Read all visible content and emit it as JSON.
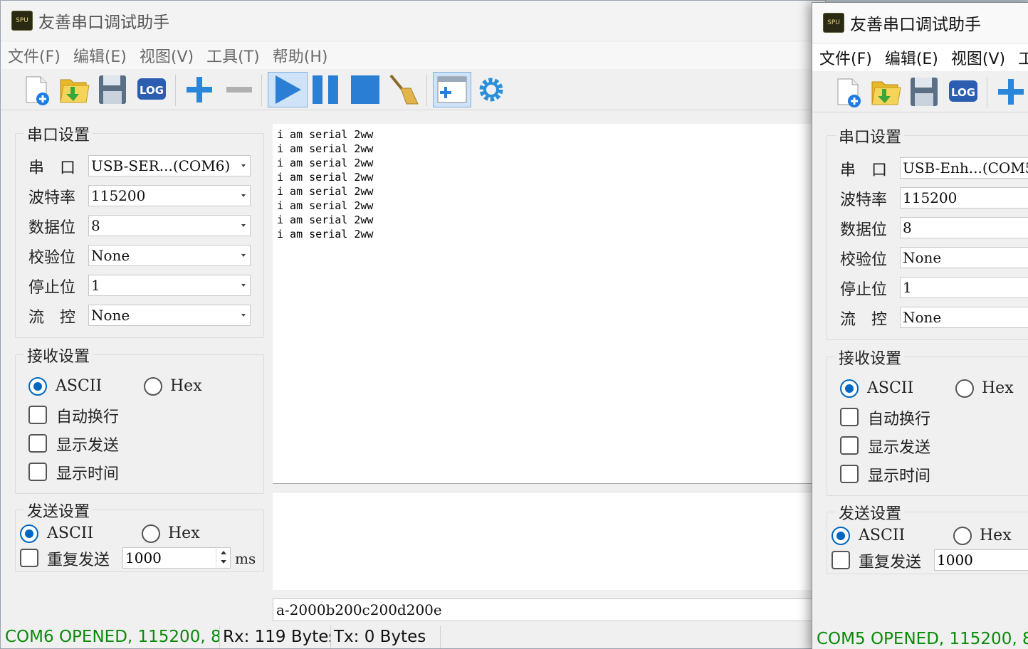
{
  "left_window": {
    "title": "友善串口调试助手",
    "icon_text": "SPU",
    "menu": [
      "文件(F)",
      "编辑(E)",
      "视图(V)",
      "工具(T)",
      "帮助(H)"
    ],
    "serial_settings": {
      "title": "串口设置",
      "port_label": "串　口",
      "port_value": "USB-SER...(COM6)",
      "baud_label": "波特率",
      "baud_value": "115200",
      "databits_label": "数据位",
      "databits_value": "8",
      "parity_label": "校验位",
      "parity_value": "None",
      "stopbits_label": "停止位",
      "stopbits_value": "1",
      "flow_label": "流　控",
      "flow_value": "None"
    },
    "receive_settings": {
      "title": "接收设置",
      "ascii_label": "ASCII",
      "hex_label": "Hex",
      "ascii_selected": true,
      "auto_wrap_label": "自动换行",
      "show_send_label": "显示发送",
      "show_time_label": "显示时间"
    },
    "send_settings": {
      "title": "发送设置",
      "ascii_label": "ASCII",
      "hex_label": "Hex",
      "ascii_selected": true,
      "repeat_label": "重复发送",
      "repeat_value": "1000",
      "unit": "ms"
    },
    "receive_lines": [
      "i am serial 2ww",
      "i am serial 2ww",
      "i am serial 2ww",
      "i am serial 2ww",
      "i am serial 2ww",
      "i am serial 2ww",
      "i am serial 2ww",
      "i am serial 2ww"
    ],
    "send_input_value": "a-2000b200c200d200e",
    "status": {
      "port": "COM6 OPENED, 115200, 8",
      "rx": "Rx: 119 Bytes",
      "tx": "Tx: 0 Bytes"
    }
  },
  "right_window": {
    "title": "友善串口调试助手",
    "icon_text": "SPU",
    "menu": [
      "文件(F)",
      "编辑(E)",
      "视图(V)",
      "工"
    ],
    "serial_settings": {
      "title": "串口设置",
      "port_label": "串　口",
      "port_value": "USB-Enh...(COM5",
      "baud_label": "波特率",
      "baud_value": "115200",
      "databits_label": "数据位",
      "databits_value": "8",
      "parity_label": "校验位",
      "parity_value": "None",
      "stopbits_label": "停止位",
      "stopbits_value": "1",
      "flow_label": "流　控",
      "flow_value": "None"
    },
    "receive_settings": {
      "title": "接收设置",
      "ascii_label": "ASCII",
      "hex_label": "Hex",
      "ascii_selected": true,
      "auto_wrap_label": "自动换行",
      "show_send_label": "显示发送",
      "show_time_label": "显示时间"
    },
    "send_settings": {
      "title": "发送设置",
      "ascii_label": "ASCII",
      "hex_label": "Hex",
      "ascii_selected": true,
      "repeat_label": "重复发送",
      "repeat_value": "1000"
    },
    "status": {
      "port": "COM5 OPENED, 115200, 8"
    }
  },
  "toolbar_icons": [
    "new-file-icon",
    "open-folder-icon",
    "save-icon",
    "log-icon",
    "add-icon",
    "remove-icon",
    "play-icon",
    "pause-icon",
    "stop-icon",
    "broom-icon",
    "new-window-icon",
    "settings-gear-icon"
  ],
  "colors": {
    "accent": "#0067c0",
    "status_green": "#0a8a0a",
    "toolbar_blue": "#2a7fd4"
  }
}
